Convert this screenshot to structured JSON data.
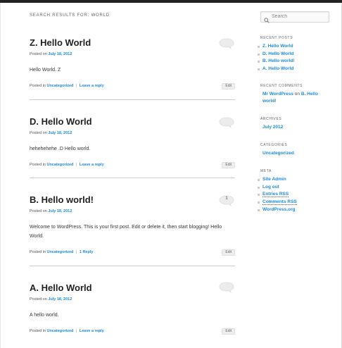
{
  "header": {
    "search_results_title": "SEARCH RESULTS FOR: WORLD"
  },
  "posts": [
    {
      "title": "Z. Hello World",
      "posted_on": "Posted on",
      "date": "July 18, 2012",
      "content": "Hello World. Z",
      "posted_in": "Posted in",
      "category": "Uncategorized",
      "separator": "|",
      "reply": "Leave a reply",
      "edit": "Edit",
      "comment_count": ""
    },
    {
      "title": "D. Hello World",
      "posted_on": "Posted on",
      "date": "July 18, 2012",
      "content": "hehehehehe .D Hello world.",
      "posted_in": "Posted in",
      "category": "Uncategorized",
      "separator": "|",
      "reply": "Leave a reply",
      "edit": "Edit",
      "comment_count": ""
    },
    {
      "title": "B. Hello world!",
      "posted_on": "Posted on",
      "date": "July 18, 2012",
      "content": "Welcome to WordPress. This is your first post. Edit or delete it, then start blogging! Hello World.",
      "posted_in": "Posted in",
      "category": "Uncategorized",
      "separator": "|",
      "reply": "1 Reply",
      "edit": "Edit",
      "comment_count": "1"
    },
    {
      "title": "A. Hello World",
      "posted_on": "Posted on",
      "date": "July 18, 2012",
      "content": "A hello world.",
      "posted_in": "Posted in",
      "category": "Uncategorized",
      "separator": "|",
      "reply": "Leave a reply",
      "edit": "Edit",
      "comment_count": ""
    }
  ],
  "sidebar": {
    "search": {
      "placeholder": "Search",
      "icon": "search-icon"
    },
    "recent_posts": {
      "title": "RECENT POSTS",
      "items": [
        "Z. Hello World",
        "D. Hello World",
        "B. Hello world!",
        "A. Hello World"
      ]
    },
    "recent_comments": {
      "title": "RECENT COMMENTS",
      "author": "Mr WordPress",
      "on": "on",
      "post": "B. Hello",
      "post_cont": "world!"
    },
    "archives": {
      "title": "ARCHIVES",
      "items": [
        "July 2012"
      ]
    },
    "categories": {
      "title": "CATEGORIES",
      "items": [
        "Uncategorized"
      ]
    },
    "meta": {
      "title": "META",
      "items": [
        "Site Admin",
        "Log out",
        "Entries RSS",
        "Comments RSS",
        "WordPress.org"
      ]
    }
  },
  "colors": {
    "link": "#1b8be0",
    "text": "#373737",
    "topbar": "#222222"
  }
}
